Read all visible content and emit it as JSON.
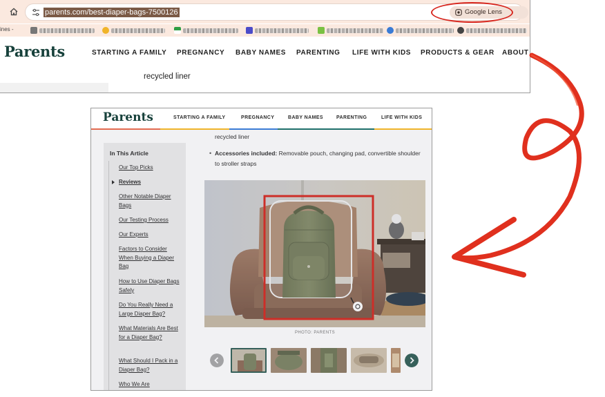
{
  "browser": {
    "url": "parents.com/best-diaper-bags-7500126",
    "lens_label": "Google Lens",
    "bookmarks_prefix": "ines -",
    "accent_color": "#d7261e"
  },
  "site": {
    "logo": "Parents",
    "nav_top": [
      "STARTING A FAMILY",
      "PREGNANCY",
      "BABY NAMES",
      "PARENTING",
      "LIFE WITH KIDS",
      "PRODUCTS & GEAR",
      "ABOUT U"
    ],
    "nav_low": [
      "STARTING A FAMILY",
      "PREGNANCY",
      "BABY NAMES",
      "PARENTING",
      "LIFE WITH KIDS"
    ],
    "stripe_colors": [
      "#e36a4f",
      "#f0b429",
      "#1f6f6a",
      "#3a7bd5",
      "#7ac143",
      "#1f6f6a",
      "#e36a4f"
    ],
    "brand_color": "#17413b"
  },
  "article": {
    "recycled_line": "recycled liner",
    "accessories_label": "Accessories included:",
    "accessories_text": " Removable pouch, changing pad, convertible shoulder to stroller straps",
    "photo_caption": "PHOTO: PARENTS"
  },
  "toc": {
    "title": "In This Article",
    "items": [
      {
        "label": "Our Top Picks"
      },
      {
        "label": "Reviews"
      },
      {
        "label": "Other Notable Diaper Bags"
      },
      {
        "label": "Our Testing Process"
      },
      {
        "label": "Our Experts"
      },
      {
        "label": "Factors to Consider When Buying a Diaper Bag"
      },
      {
        "label": "How to Use Diaper Bags Safely"
      },
      {
        "label": "Do You Really Need a Large Diaper Bag?"
      },
      {
        "label": "What Materials Are Best for a Diaper Bag?"
      },
      {
        "label": "What Should I Pack in a Diaper Bag?"
      },
      {
        "label": "Who We Are"
      }
    ],
    "active": "Reviews"
  },
  "icons": {
    "home": "home-icon",
    "site_settings": "tune-icon",
    "lens": "google-lens-icon",
    "bookmark": "star-icon",
    "carousel_prev": "chevron-left-icon",
    "carousel_next": "chevron-right-icon",
    "annotation_arrow": "red-curved-arrow-icon"
  }
}
